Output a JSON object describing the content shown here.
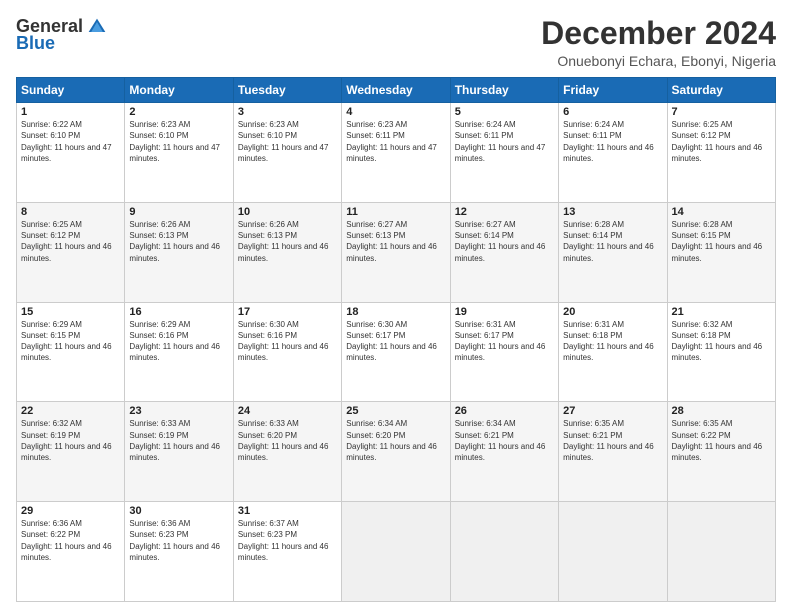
{
  "header": {
    "logo_general": "General",
    "logo_blue": "Blue",
    "title": "December 2024",
    "subtitle": "Onuebonyi Echara, Ebonyi, Nigeria"
  },
  "days_of_week": [
    "Sunday",
    "Monday",
    "Tuesday",
    "Wednesday",
    "Thursday",
    "Friday",
    "Saturday"
  ],
  "weeks": [
    [
      {
        "day": 1,
        "rise": "6:22 AM",
        "set": "6:10 PM",
        "daylight": "11 hours and 47 minutes."
      },
      {
        "day": 2,
        "rise": "6:23 AM",
        "set": "6:10 PM",
        "daylight": "11 hours and 47 minutes."
      },
      {
        "day": 3,
        "rise": "6:23 AM",
        "set": "6:10 PM",
        "daylight": "11 hours and 47 minutes."
      },
      {
        "day": 4,
        "rise": "6:23 AM",
        "set": "6:11 PM",
        "daylight": "11 hours and 47 minutes."
      },
      {
        "day": 5,
        "rise": "6:24 AM",
        "set": "6:11 PM",
        "daylight": "11 hours and 47 minutes."
      },
      {
        "day": 6,
        "rise": "6:24 AM",
        "set": "6:11 PM",
        "daylight": "11 hours and 46 minutes."
      },
      {
        "day": 7,
        "rise": "6:25 AM",
        "set": "6:12 PM",
        "daylight": "11 hours and 46 minutes."
      }
    ],
    [
      {
        "day": 8,
        "rise": "6:25 AM",
        "set": "6:12 PM",
        "daylight": "11 hours and 46 minutes."
      },
      {
        "day": 9,
        "rise": "6:26 AM",
        "set": "6:13 PM",
        "daylight": "11 hours and 46 minutes."
      },
      {
        "day": 10,
        "rise": "6:26 AM",
        "set": "6:13 PM",
        "daylight": "11 hours and 46 minutes."
      },
      {
        "day": 11,
        "rise": "6:27 AM",
        "set": "6:13 PM",
        "daylight": "11 hours and 46 minutes."
      },
      {
        "day": 12,
        "rise": "6:27 AM",
        "set": "6:14 PM",
        "daylight": "11 hours and 46 minutes."
      },
      {
        "day": 13,
        "rise": "6:28 AM",
        "set": "6:14 PM",
        "daylight": "11 hours and 46 minutes."
      },
      {
        "day": 14,
        "rise": "6:28 AM",
        "set": "6:15 PM",
        "daylight": "11 hours and 46 minutes."
      }
    ],
    [
      {
        "day": 15,
        "rise": "6:29 AM",
        "set": "6:15 PM",
        "daylight": "11 hours and 46 minutes."
      },
      {
        "day": 16,
        "rise": "6:29 AM",
        "set": "6:16 PM",
        "daylight": "11 hours and 46 minutes."
      },
      {
        "day": 17,
        "rise": "6:30 AM",
        "set": "6:16 PM",
        "daylight": "11 hours and 46 minutes."
      },
      {
        "day": 18,
        "rise": "6:30 AM",
        "set": "6:17 PM",
        "daylight": "11 hours and 46 minutes."
      },
      {
        "day": 19,
        "rise": "6:31 AM",
        "set": "6:17 PM",
        "daylight": "11 hours and 46 minutes."
      },
      {
        "day": 20,
        "rise": "6:31 AM",
        "set": "6:18 PM",
        "daylight": "11 hours and 46 minutes."
      },
      {
        "day": 21,
        "rise": "6:32 AM",
        "set": "6:18 PM",
        "daylight": "11 hours and 46 minutes."
      }
    ],
    [
      {
        "day": 22,
        "rise": "6:32 AM",
        "set": "6:19 PM",
        "daylight": "11 hours and 46 minutes."
      },
      {
        "day": 23,
        "rise": "6:33 AM",
        "set": "6:19 PM",
        "daylight": "11 hours and 46 minutes."
      },
      {
        "day": 24,
        "rise": "6:33 AM",
        "set": "6:20 PM",
        "daylight": "11 hours and 46 minutes."
      },
      {
        "day": 25,
        "rise": "6:34 AM",
        "set": "6:20 PM",
        "daylight": "11 hours and 46 minutes."
      },
      {
        "day": 26,
        "rise": "6:34 AM",
        "set": "6:21 PM",
        "daylight": "11 hours and 46 minutes."
      },
      {
        "day": 27,
        "rise": "6:35 AM",
        "set": "6:21 PM",
        "daylight": "11 hours and 46 minutes."
      },
      {
        "day": 28,
        "rise": "6:35 AM",
        "set": "6:22 PM",
        "daylight": "11 hours and 46 minutes."
      }
    ],
    [
      {
        "day": 29,
        "rise": "6:36 AM",
        "set": "6:22 PM",
        "daylight": "11 hours and 46 minutes."
      },
      {
        "day": 30,
        "rise": "6:36 AM",
        "set": "6:23 PM",
        "daylight": "11 hours and 46 minutes."
      },
      {
        "day": 31,
        "rise": "6:37 AM",
        "set": "6:23 PM",
        "daylight": "11 hours and 46 minutes."
      },
      null,
      null,
      null,
      null
    ]
  ]
}
